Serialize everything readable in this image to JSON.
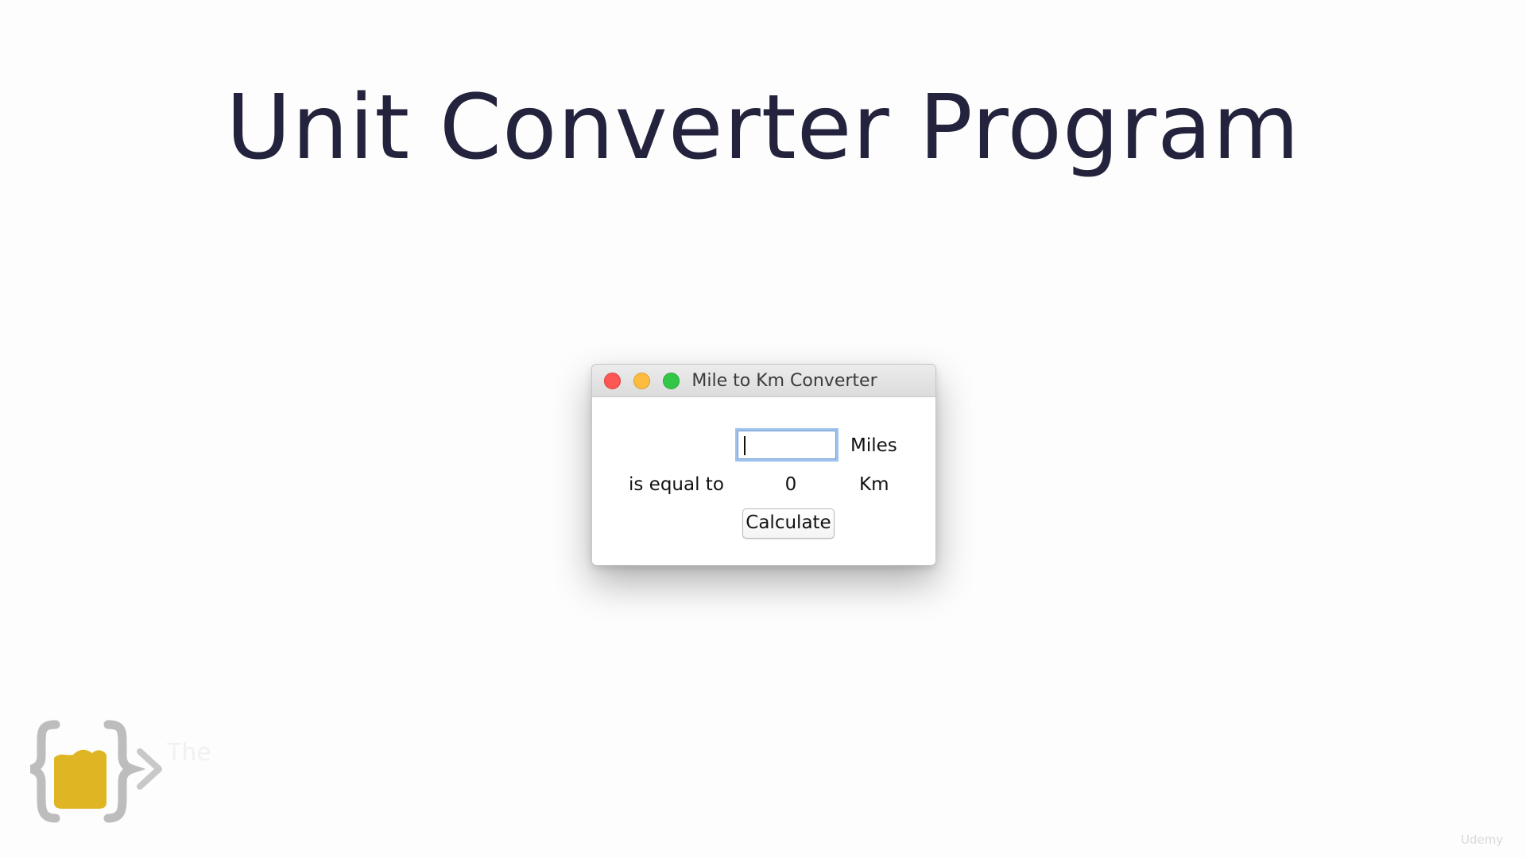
{
  "slide": {
    "title": "Unit Converter Program"
  },
  "window": {
    "title": "Mile to Km Converter",
    "controls": {
      "close_color": "#fc5753",
      "minimize_color": "#fdbc40",
      "zoom_color": "#33c748"
    }
  },
  "form": {
    "miles_input_value": "",
    "miles_label": "Miles",
    "equal_label": "is equal to",
    "result_value": "0",
    "km_label": "Km",
    "calculate_label": "Calculate"
  },
  "branding": {
    "logo_icon": "code-braces-logo-icon",
    "logo_text": "The",
    "watermark_text": "Udemy",
    "logo_colors": {
      "brace": "#bdbdbd",
      "fill": "#e0b524"
    }
  }
}
